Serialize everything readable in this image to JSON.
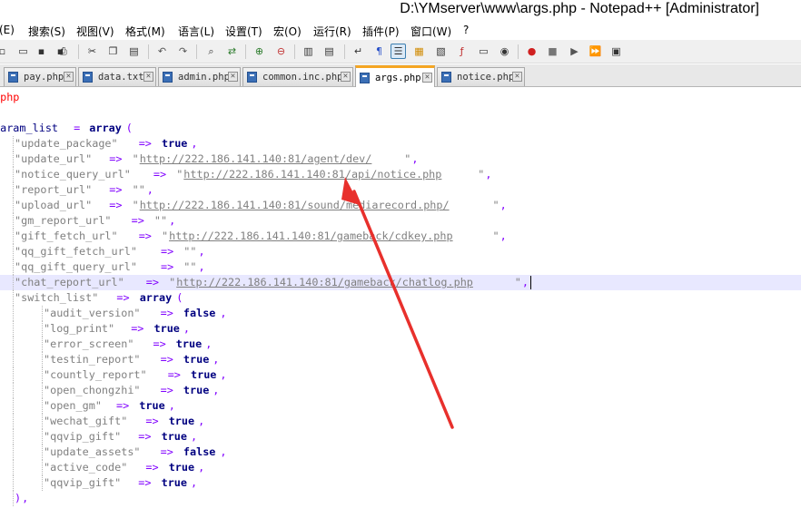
{
  "window": {
    "title": "D:\\YMserver\\www\\args.php - Notepad++ [Administrator]"
  },
  "menu": [
    "(E)",
    "搜索(S)",
    "视图(V)",
    "格式(M)",
    "语言(L)",
    "设置(T)",
    "宏(O)",
    "运行(R)",
    "插件(P)",
    "窗口(W)",
    "?"
  ],
  "toolbar": {
    "icons": [
      "new-file-icon",
      "open-file-icon",
      "save-icon",
      "save-all-icon",
      "close-icon",
      "close-all-icon",
      "print-icon",
      "cut-icon",
      "copy-icon",
      "paste-icon",
      "undo-icon",
      "redo-icon",
      "find-icon",
      "replace-icon",
      "zoom-in-icon",
      "zoom-out-icon",
      "sync-vertical-icon",
      "sync-horizontal-icon",
      "word-wrap-icon",
      "show-all-chars-icon",
      "indent-guide-icon",
      "user-defined-language-icon",
      "document-map-icon",
      "function-list-icon",
      "folder-workspace-icon",
      "monitoring-icon",
      "record-macro-icon",
      "stop-record-icon",
      "playback-macro-icon",
      "run-macro-multiple-icon",
      "save-macro-icon"
    ]
  },
  "tabs": [
    {
      "label": "pay.php",
      "active": false
    },
    {
      "label": "data.txt",
      "active": false
    },
    {
      "label": "admin.php",
      "active": false
    },
    {
      "label": "common.inc.php",
      "active": false
    },
    {
      "label": "args.php",
      "active": true
    },
    {
      "label": "notice.php",
      "active": false
    }
  ],
  "editor": {
    "open_tag": "?php",
    "lines": [
      {
        "t": "tag",
        "text": "?php"
      },
      {
        "t": "blank"
      },
      {
        "t": "assign",
        "var": "param_list",
        "op": " = ",
        "kw": "array",
        "paren": "("
      },
      {
        "t": "kv",
        "key": "\"update_package\"",
        "val": "true",
        "vt": "k",
        "indent": 1
      },
      {
        "t": "kv",
        "key": "\"update_url\"",
        "val": "http://222.186.141.140:81/agent/dev/",
        "vt": "u",
        "indent": 1
      },
      {
        "t": "kv",
        "key": "\"notice_query_url\"",
        "val": "http://222.186.141.140:81/api/notice.php",
        "vt": "u",
        "indent": 1
      },
      {
        "t": "kv",
        "key": "\"report_url\"",
        "val": "\"\"",
        "vt": "s",
        "indent": 1
      },
      {
        "t": "kv",
        "key": "\"upload_url\"",
        "val": "http://222.186.141.140:81/sound/mediarecord.php/",
        "vt": "u",
        "indent": 1
      },
      {
        "t": "kv",
        "key": "\"gm_report_url\"",
        "val": "\"\"",
        "vt": "s",
        "indent": 1
      },
      {
        "t": "kv",
        "key": "\"gift_fetch_url\"",
        "val": "http://222.186.141.140:81/gameback/cdkey.php",
        "vt": "u",
        "indent": 1
      },
      {
        "t": "kv",
        "key": "\"qq_gift_fetch_url\"",
        "val": "\"\"",
        "vt": "s",
        "indent": 1
      },
      {
        "t": "kv",
        "key": "\"qq_gift_query_url\"",
        "val": "\"\"",
        "vt": "s",
        "indent": 1
      },
      {
        "t": "kv",
        "key": "\"chat_report_url\"",
        "val": "http://222.186.141.140:81/gameback/chatlog.php",
        "vt": "u",
        "indent": 1,
        "current": true
      },
      {
        "t": "kvarr",
        "key": "\"switch_list\"",
        "kw": "array",
        "paren": "(",
        "indent": 1
      },
      {
        "t": "kv",
        "key": "\"audit_version\"",
        "val": "false",
        "vt": "k",
        "indent": 2
      },
      {
        "t": "kv",
        "key": "\"log_print\"",
        "val": "true",
        "vt": "k",
        "indent": 2
      },
      {
        "t": "kv",
        "key": "\"error_screen\"",
        "val": "true",
        "vt": "k",
        "indent": 2
      },
      {
        "t": "kv",
        "key": "\"testin_report\"",
        "val": "true",
        "vt": "k",
        "indent": 2
      },
      {
        "t": "kv",
        "key": "\"countly_report\"",
        "val": "true",
        "vt": "k",
        "indent": 2
      },
      {
        "t": "kv",
        "key": "\"open_chongzhi\"",
        "val": "true",
        "vt": "k",
        "indent": 2
      },
      {
        "t": "kv",
        "key": "\"open_gm\"",
        "val": "true",
        "vt": "k",
        "indent": 2
      },
      {
        "t": "kv",
        "key": "\"wechat_gift\"",
        "val": "true",
        "vt": "k",
        "indent": 2
      },
      {
        "t": "kv",
        "key": "\"qqvip_gift\"",
        "val": "true",
        "vt": "k",
        "indent": 2
      },
      {
        "t": "kv",
        "key": "\"update_assets\"",
        "val": "false",
        "vt": "k",
        "indent": 2
      },
      {
        "t": "kv",
        "key": "\"active_code\"",
        "val": "true",
        "vt": "k",
        "indent": 2
      },
      {
        "t": "kv",
        "key": "\"qqvip_gift\"",
        "val": "true",
        "vt": "k",
        "indent": 2
      },
      {
        "t": "close",
        "text": ")",
        "indent": 1
      }
    ]
  },
  "annotation": {
    "arrow_color": "#e8302c"
  }
}
